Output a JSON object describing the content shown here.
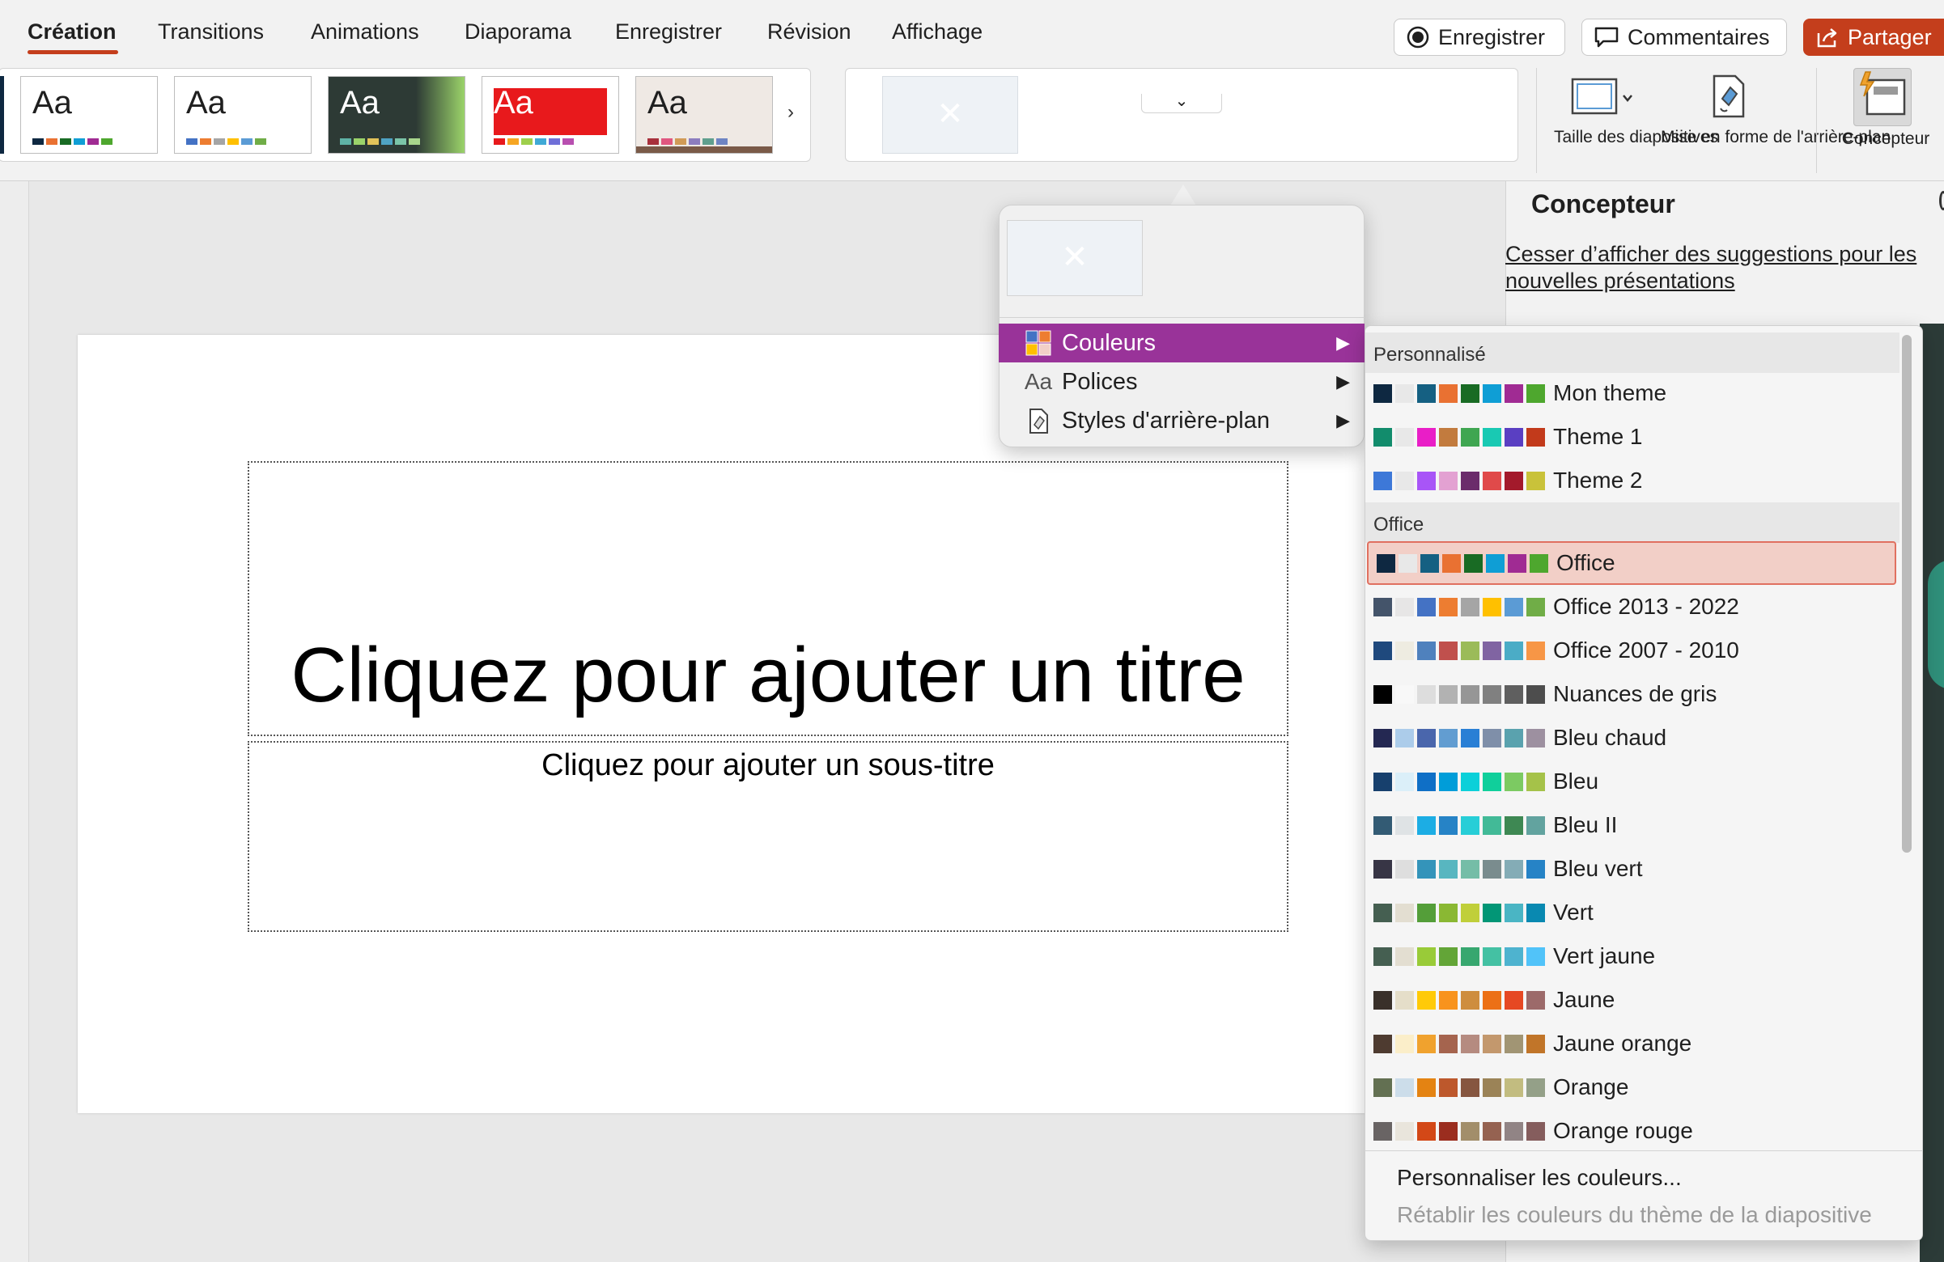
{
  "tabs": [
    "Création",
    "Transitions",
    "Animations",
    "Diaporama",
    "Enregistrer",
    "Révision",
    "Affichage"
  ],
  "top_buttons": {
    "record": "Enregistrer",
    "comments": "Commentaires",
    "share": "Partager"
  },
  "themes": [
    {
      "label": "Aa",
      "bg": "#ffffff",
      "text": "#1f1f1f",
      "colors": [
        "#0e2841",
        "#e97132",
        "#196b24",
        "#0f9ed5",
        "#a02b93",
        "#4ea72e"
      ]
    },
    {
      "label": "Aa",
      "bg": "#ffffff",
      "text": "#1f1f1f",
      "colors": [
        "#4472c4",
        "#ed7d31",
        "#a5a5a5",
        "#ffc000",
        "#5b9bd5",
        "#70ad47"
      ]
    },
    {
      "label": "Aa",
      "bg": "#2d3a35",
      "text": "#ffffff",
      "colors": [
        "#5fb3a6",
        "#9bd36a",
        "#e2c35a",
        "#4fa3c4",
        "#7bc4a8",
        "#a8d58c"
      ]
    },
    {
      "label": "Aa",
      "bg": "#ffffff",
      "text": "#ffffff",
      "colors": [
        "#e8191c",
        "#f6a623",
        "#9ecf4b",
        "#3fa9d6",
        "#6f6fd8",
        "#b84fb0"
      ]
    },
    {
      "label": "Aa",
      "bg": "#efe9e4",
      "text": "#1f1f1f",
      "colors": [
        "#a8303b",
        "#e0567f",
        "#d19a56",
        "#8c7dbf",
        "#5f9f8e",
        "#6e84c3"
      ]
    }
  ],
  "ribbon": {
    "slide_size": "Taille des diapositives",
    "background_format": "Mise en forme de l'arrière-plan",
    "designer": "Concepteur"
  },
  "slide": {
    "title": "Cliquez pour ajouter un titre",
    "subtitle": "Cliquez pour ajouter un sous-titre"
  },
  "pane": {
    "title": "Concepteur",
    "link": "Cesser d’afficher des suggestions pour les nouvelles présentations"
  },
  "variants_menu": {
    "items": [
      {
        "label": "Couleurs",
        "icon": "colors-icon"
      },
      {
        "label": "Polices",
        "icon": "fonts-icon"
      },
      {
        "label": "Styles d'arrière-plan",
        "icon": "background-styles-icon"
      }
    ]
  },
  "colors_submenu": {
    "custom_header": "Personnalisé",
    "office_header": "Office",
    "custom": [
      {
        "name": "Mon theme",
        "colors": [
          "#0e2841",
          "#e8e8e8",
          "#156082",
          "#e97132",
          "#196b24",
          "#0f9ed5",
          "#a02b93",
          "#4ea72e"
        ]
      },
      {
        "name": "Theme 1",
        "colors": [
          "#128c6c",
          "#e8e8e8",
          "#e91ec7",
          "#c27b3e",
          "#3fa651",
          "#19c9b3",
          "#5a3fc2",
          "#c23a1b"
        ]
      },
      {
        "name": "Theme 2",
        "colors": [
          "#3d78d8",
          "#e8e8e8",
          "#a855f7",
          "#e3a1d2",
          "#6b2c6b",
          "#e04a4a",
          "#a31a2b",
          "#c9c23a"
        ]
      }
    ],
    "office": [
      {
        "name": "Office",
        "colors": [
          "#0e2841",
          "#e8e8e8",
          "#156082",
          "#e97132",
          "#196b24",
          "#0f9ed5",
          "#a02b93",
          "#4ea72e"
        ]
      },
      {
        "name": "Office 2013 - 2022",
        "colors": [
          "#44546a",
          "#e7e6e6",
          "#4472c4",
          "#ed7d31",
          "#a5a5a5",
          "#ffc000",
          "#5b9bd5",
          "#70ad47"
        ]
      },
      {
        "name": "Office 2007 - 2010",
        "colors": [
          "#1f497d",
          "#eeece1",
          "#4f81bd",
          "#c0504d",
          "#9bbb59",
          "#8064a2",
          "#4bacc6",
          "#f79646"
        ]
      },
      {
        "name": "Nuances de gris",
        "colors": [
          "#000000",
          "#f8f8f8",
          "#dddddd",
          "#b2b2b2",
          "#969696",
          "#808080",
          "#5f5f5f",
          "#4d4d4d"
        ]
      },
      {
        "name": "Bleu chaud",
        "colors": [
          "#242852",
          "#acccea",
          "#4a66ac",
          "#629dd1",
          "#297fd5",
          "#7f8fa9",
          "#5aa2ae",
          "#9d90a0"
        ]
      },
      {
        "name": "Bleu",
        "colors": [
          "#17406d",
          "#dbeff9",
          "#0f6fc6",
          "#009dd9",
          "#0bd0d9",
          "#10cf9b",
          "#7cca62",
          "#a5c249"
        ]
      },
      {
        "name": "Bleu II",
        "colors": [
          "#335b74",
          "#dfe3e5",
          "#1cade4",
          "#2683c6",
          "#27ced7",
          "#42ba97",
          "#3e8853",
          "#62a39f"
        ]
      },
      {
        "name": "Bleu vert",
        "colors": [
          "#373545",
          "#dedede",
          "#3494ba",
          "#58b6c0",
          "#75bda7",
          "#7a8c8e",
          "#84acb6",
          "#2683c6"
        ]
      },
      {
        "name": "Vert",
        "colors": [
          "#455f51",
          "#e3ded1",
          "#549e39",
          "#8ab833",
          "#c0cf3a",
          "#029676",
          "#4ab5c4",
          "#0989b1"
        ]
      },
      {
        "name": "Vert jaune",
        "colors": [
          "#455f51",
          "#e3ded1",
          "#99cb38",
          "#63a537",
          "#37a76f",
          "#44c1a3",
          "#4eb3cf",
          "#51c3f9"
        ]
      },
      {
        "name": "Jaune",
        "colors": [
          "#39302a",
          "#e5dec9",
          "#ffca08",
          "#f8931d",
          "#ce8d3e",
          "#ec7016",
          "#e64823",
          "#9c6a6a"
        ]
      },
      {
        "name": "Jaune orange",
        "colors": [
          "#4e3b30",
          "#fbeec9",
          "#f0a22e",
          "#a5644e",
          "#b58b80",
          "#c3986d",
          "#a19574",
          "#c17529"
        ]
      },
      {
        "name": "Orange",
        "colors": [
          "#637052",
          "#ccddea",
          "#e48312",
          "#bd582c",
          "#865640",
          "#9b8357",
          "#c2bc80",
          "#94a088"
        ]
      },
      {
        "name": "Orange rouge",
        "colors": [
          "#696464",
          "#e9e5dc",
          "#d34817",
          "#9b2d1f",
          "#a28e6a",
          "#956251",
          "#918485",
          "#855d5d"
        ]
      }
    ],
    "customize": "Personnaliser les couleurs...",
    "reset": "Rétablir les couleurs du thème de la diapositive"
  }
}
